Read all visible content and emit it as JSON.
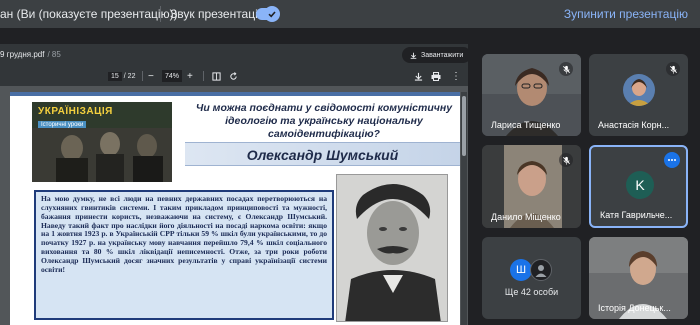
{
  "topbar": {
    "presenter_label": "ан (Ви (показуєте презентацію))",
    "audio_label": "Звук презентації",
    "audio_on": true,
    "stop_label": "Зупинити презентацію"
  },
  "viewer": {
    "file_name": "9 грудня.pdf",
    "file_size": "/ 85",
    "download_chip": "Завантажити",
    "page_current": "15",
    "page_total": "/ 22",
    "zoom": "74%"
  },
  "slide": {
    "banner_brand": "УКРАЇНІЗАЦІЯ",
    "banner_tag": "Історичні уроки",
    "question": "Чи можна поєднати у свідомості комуністичну ідеологію та українську національну самоідентифікацію?",
    "name": "Олександр Шумський",
    "quote": "На мою думку, не всі люди на певних державних посадах перетворюються на слухняних гвинтиків системи. І таким прикладом принциповості та мужності, бажання принести користь, незважаючи на систему, є Олександр Шумський. Наведу такий факт про наслідки його діяльності на посаді наркома освіти: якщо на 1 жовтня 1923 р. в Українській СРР тільки 59 % шкіл були українськими, то до початку 1927 р. на українську мову навчання перейшло 79,4 % шкіл соціального виховання та 80 % шкіл ліквідації неписемності. Отже, за три роки роботи Олександр Шумський досяг значних результатів у справі українізації системи освіти!"
  },
  "participants": [
    {
      "name": "Лариса Тищенко",
      "muted": true
    },
    {
      "name": "Анастасія Корн...",
      "muted": true
    },
    {
      "name": "Данило Міщенко",
      "muted": true
    },
    {
      "name": "Катя Гаврильче...",
      "initial": "K",
      "active": true
    },
    {
      "label": "Ще 42 особи",
      "initial": "Ш"
    },
    {
      "name": "Історія Донецьк..."
    }
  ],
  "colors": {
    "accent": "#8ab4f8",
    "tile_bg": "#3c4043",
    "bg": "#202124",
    "quote_border": "#1f3b7a"
  }
}
